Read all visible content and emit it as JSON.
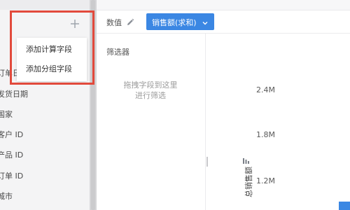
{
  "field_panel": {
    "items": [
      {
        "label": "订单日"
      },
      {
        "label": "发货日期"
      },
      {
        "label": "国家"
      },
      {
        "label": "客户 ID"
      },
      {
        "label": "产品 ID"
      },
      {
        "label": "订单 ID"
      },
      {
        "label": "城市"
      }
    ],
    "add_icon": "plus-icon"
  },
  "popup_menu": {
    "items": [
      {
        "label": "添加计算字段"
      },
      {
        "label": "添加分组字段"
      }
    ]
  },
  "values_row": {
    "label": "数值",
    "edit_icon": "pencil-icon",
    "pill_label": "销售额(求和)",
    "pill_icon": "chevron-down-icon",
    "pill_color": "#3b87e3"
  },
  "filter_panel": {
    "title": "筛选器",
    "hint_line1": "拖拽字段到这里",
    "hint_line2": "进行筛选"
  },
  "chart_data": {
    "type": "bar",
    "ylabel": "总销售额",
    "y_ticks": [
      "2.4M",
      "1.8M",
      "1.2M"
    ]
  },
  "colors": {
    "accent": "#3b87e3",
    "highlight_border": "#e24a3c"
  }
}
